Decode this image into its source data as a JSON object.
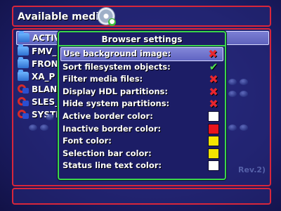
{
  "header": {
    "title": "Available media:",
    "device_icon": "disc-icon"
  },
  "file_list": [
    {
      "name": "ACTIV",
      "icon": "folder-icon",
      "selected": true
    },
    {
      "name": "FMV_P",
      "icon": "folder-icon",
      "selected": false
    },
    {
      "name": "FRONT",
      "icon": "folder-icon",
      "selected": false
    },
    {
      "name": "XA_P",
      "icon": "folder-icon",
      "selected": false
    },
    {
      "name": "BLANI",
      "icon": "elf-icon",
      "selected": false
    },
    {
      "name": "SLES_",
      "icon": "elf-icon",
      "selected": false
    },
    {
      "name": "SYSTE",
      "icon": "elf-icon",
      "selected": false
    }
  ],
  "background_text": "Rev.2)",
  "dialog": {
    "title": "Browser settings",
    "settings": [
      {
        "label": "Use background image:",
        "type": "bool",
        "value": false,
        "selected": true
      },
      {
        "label": "Sort filesystem objects:",
        "type": "bool",
        "value": true,
        "selected": false
      },
      {
        "label": "Filter media files:",
        "type": "bool",
        "value": false,
        "selected": false
      },
      {
        "label": "Display HDL partitions:",
        "type": "bool",
        "value": false,
        "selected": false
      },
      {
        "label": "Hide system partitions:",
        "type": "bool",
        "value": false,
        "selected": false
      },
      {
        "label": "Active border color:",
        "type": "color",
        "value": "#ffffff",
        "selected": false
      },
      {
        "label": "Inactive border color:",
        "type": "color",
        "value": "#e8141c",
        "selected": false
      },
      {
        "label": "Font color:",
        "type": "color",
        "value": "#f5e400",
        "selected": false
      },
      {
        "label": "Selection bar color:",
        "type": "color",
        "value": "#f5e400",
        "selected": false
      },
      {
        "label": "Status line text color:",
        "type": "color",
        "value": "#ffffff",
        "selected": false
      }
    ]
  },
  "status_line": {
    "text": ""
  },
  "colors": {
    "frame_border": "#d8263b",
    "dialog_border": "#3bd64b",
    "panel_background": "#1d1f6a",
    "selection_bar": "#6e72cc"
  }
}
